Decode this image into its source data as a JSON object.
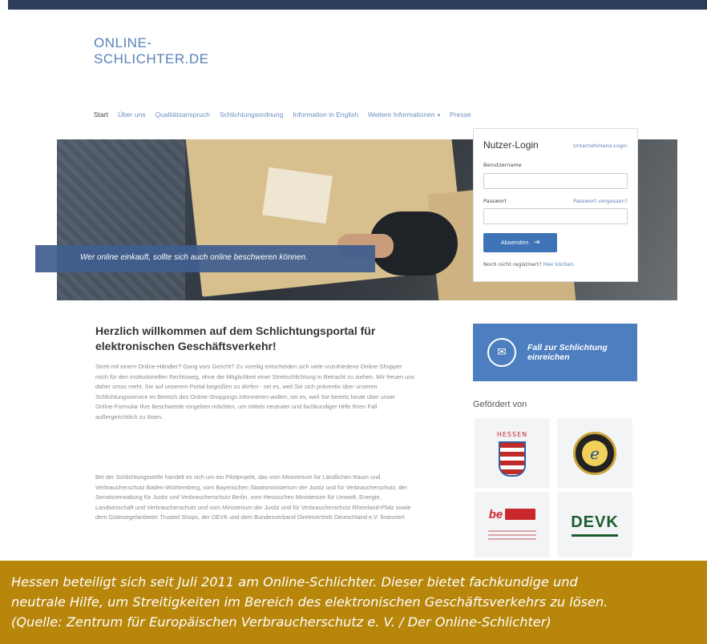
{
  "logo": {
    "line1": "ONLINE-",
    "line2": "SCHLICHTER.DE"
  },
  "nav": {
    "items": [
      {
        "label": "Start",
        "active": true
      },
      {
        "label": "Über uns"
      },
      {
        "label": "Qualitätsanspruch"
      },
      {
        "label": "Schlichtungsordnung"
      },
      {
        "label": "Information in English"
      },
      {
        "label": "Weitere Informationen",
        "dropdown": true
      },
      {
        "label": "Presse"
      }
    ]
  },
  "hero": {
    "banner_text": "Wer online einkauft, sollte sich auch online beschweren können."
  },
  "login": {
    "title": "Nutzer-Login",
    "company_login_link": "Unternehmens-Login",
    "username_label": "Benutzername",
    "username_value": "",
    "password_label": "Passwort",
    "password_value": "",
    "forgot_link": "Passwort vergessen?",
    "submit_label": "Absenden",
    "register_text": "Noch nicht registriert?",
    "register_link": "Hier klicken."
  },
  "welcome": {
    "title": "Herzlich willkommen auf dem Schlichtungsportal für elektronischen Geschäftsverkehr!",
    "paragraph1": "Streit mit einem Online-Händler? Gang vors Gericht? Zu voreilig entscheiden sich viele unzufriedene Online-Shopper noch für den institutionellen Rechtsweg, ohne die Möglichkeit einer Streitschlichtung in Betracht zu ziehen. Wir freuen uns daher umso mehr, Sie auf unserem Portal begrüßen zu dürfen - sei es, weil Sie sich präventiv über unseren Schlichtungsservice im Bereich des Online-Shoppings informieren wollen, sei es, weil Sie bereits heute über unser Online-Formular Ihre Beschwerde eingeben möchten, um mittels neutraler und fachkundiger Hilfe Ihren Fall außergerichtlich zu lösen.",
    "paragraph2": "Bei der Schlichtungsstelle handelt es sich um ein Pilotprojekt, das vom Ministerium für Ländlichen Raum und Verbraucherschutz Baden-Württemberg, vom Bayerischen Staatsministerium der Justiz und für Verbraucherschutz, der Senatsverwaltung für Justiz und Verbraucherschutz Berlin, vom Hessischen Ministerium für Umwelt, Energie, Landwirtschaft und Verbraucherschutz und vom Ministerium der Justiz und für Verbraucherschutz Rheinland-Pfalz sowie dem Gütesiegelanbieter Trusted Shops, der DEVK und dem Bundesverband Direktvertrieb Deutschland e.V. finanziert"
  },
  "cta": {
    "label": "Fall zur Schlichtung einreichen"
  },
  "sponsors": {
    "heading": "Gefördert von",
    "hessen": "HESSEN",
    "berlin": "Berlin",
    "devk": "DEVK"
  },
  "caption": {
    "line1": "Hessen beteiligt sich seit Juli 2011 am Online-Schlichter. Dieser bietet fachkundige und",
    "line2": "neutrale Hilfe, um Streitigkeiten im Bereich des elektronischen Geschäftsverkehrs zu lösen.",
    "line3": "(Quelle: Zentrum für Europäischen Verbraucherschutz e. V. / Der Online-Schlichter)"
  },
  "colors": {
    "accent": "#4d7fc0",
    "nav_link": "#6d8fbf",
    "caption_bg": "#b8860b",
    "topbar": "#2b3d59"
  }
}
